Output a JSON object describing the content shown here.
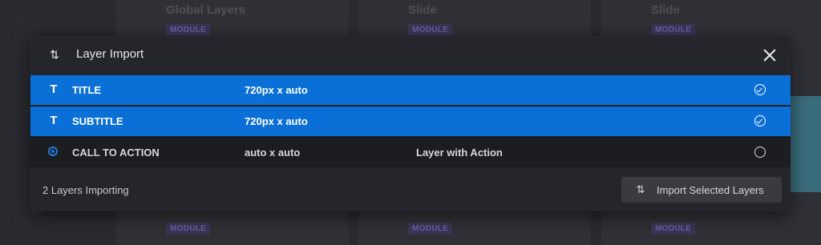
{
  "background": {
    "columns": [
      {
        "title": "Global Layers",
        "badge_top": "MODULE",
        "badge_bottom": "MODULE"
      },
      {
        "title": "Slide",
        "badge_top": "MODULE",
        "badge_bottom": "MODULE"
      },
      {
        "title": "Slide",
        "badge_top": "MODULE",
        "badge_bottom": "MODULE"
      }
    ]
  },
  "modal": {
    "title": "Layer Import",
    "icons": {
      "header": "import-arrows-icon",
      "close": "close-icon"
    },
    "layers": [
      {
        "type_icon": "T",
        "name": "TITLE",
        "size": "720px x auto",
        "action": "",
        "selected": true
      },
      {
        "type_icon": "T",
        "name": "SUBTITLE",
        "size": "720px x auto",
        "action": "",
        "selected": true
      },
      {
        "type_icon": "radio",
        "name": "CALL TO ACTION",
        "size": "auto x auto",
        "action": "Layer with Action",
        "selected": false
      }
    ],
    "footer": {
      "status": "2 Layers Importing",
      "import_button": "Import Selected Layers"
    }
  },
  "colors": {
    "accent": "#0a6fd6",
    "background": "#2a2b30",
    "modal": "#25262b",
    "badge": "#6d5fa8"
  }
}
